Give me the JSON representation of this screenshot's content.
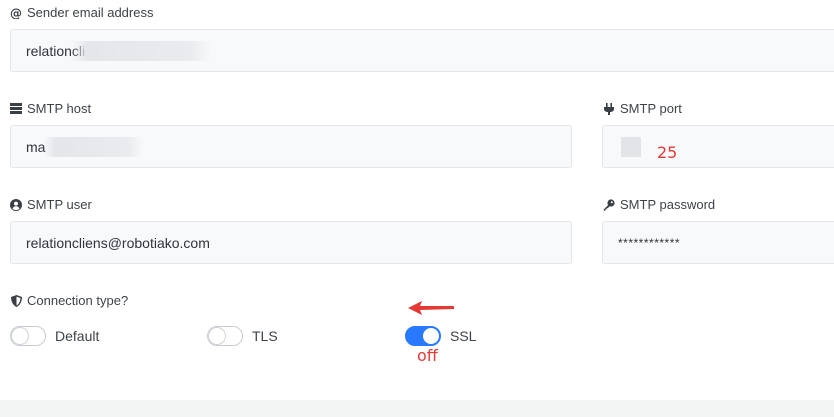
{
  "sender": {
    "label": "Sender email address",
    "icon": "at-icon",
    "value": "relationcli"
  },
  "smtp_host": {
    "label": "SMTP host",
    "icon": "server-icon",
    "value": "ma"
  },
  "smtp_port": {
    "label": "SMTP port",
    "icon": "plug-icon",
    "value": ""
  },
  "smtp_user": {
    "label": "SMTP user",
    "icon": "user-circle-icon",
    "value": "relationcliens@robotiako.com"
  },
  "smtp_password": {
    "label": "SMTP password",
    "icon": "key-icon",
    "value": "************"
  },
  "connection": {
    "label": "Connection type?",
    "icon": "shield-icon",
    "options": [
      {
        "label": "Default",
        "checked": false
      },
      {
        "label": "TLS",
        "checked": false
      },
      {
        "label": "SSL",
        "checked": true
      }
    ]
  },
  "annotations": {
    "port_note": "25",
    "ssl_note": "off",
    "color": "#e53935"
  },
  "colors": {
    "accent": "#2979ff",
    "input_bg": "#f8f9fb",
    "input_border": "#e3e6ea"
  }
}
